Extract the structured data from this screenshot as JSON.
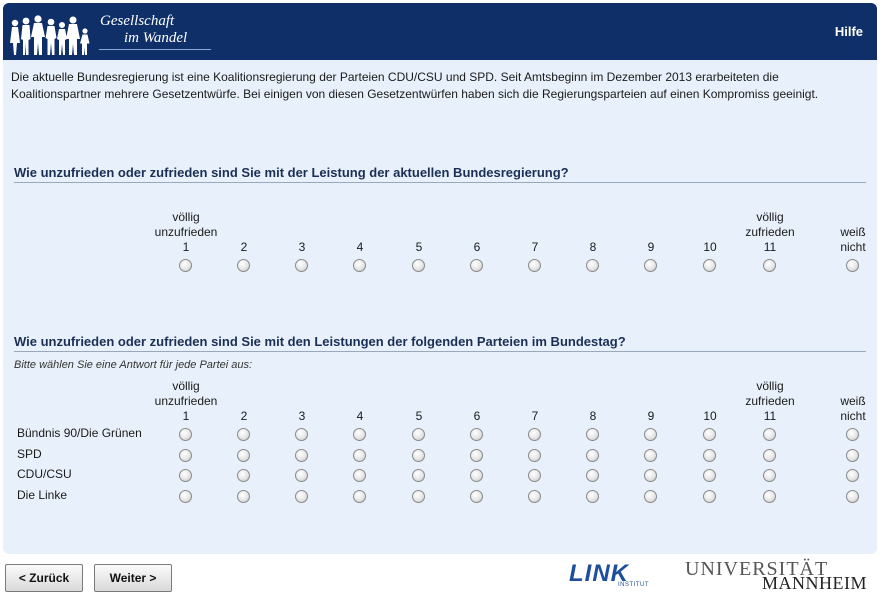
{
  "header": {
    "logo_line1": "Gesellschaft",
    "logo_line2": "im Wandel",
    "help_label": "Hilfe"
  },
  "intro_text": "Die aktuelle Bundesregierung ist eine Koalitionsregierung der Parteien CDU/CSU und SPD. Seit Amtsbeginn im Dezember 2013 erarbeiteten die Koalitionspartner mehrere Gesetzentwürfe. Bei einigen von diesen Gesetzentwürfen haben sich die Regierungsparteien auf einen Kompromiss geeinigt.",
  "scale": {
    "low_label_1": "völlig",
    "low_label_2": "unzufrieden",
    "high_label_1": "völlig",
    "high_label_2": "zufrieden",
    "dk_label_1": "weiß",
    "dk_label_2": "nicht",
    "points": [
      "1",
      "2",
      "3",
      "4",
      "5",
      "6",
      "7",
      "8",
      "9",
      "10",
      "11"
    ]
  },
  "question1": {
    "title": "Wie unzufrieden oder zufrieden sind Sie mit der Leistung der aktuellen Bundesregierung?",
    "selected": null
  },
  "question2": {
    "title": "Wie unzufrieden oder zufrieden sind Sie mit den Leistungen der folgenden Parteien im Bundestag?",
    "instruction": "Bitte wählen Sie eine Antwort für jede Partei aus:",
    "rows": [
      {
        "label": "Bündnis 90/Die Grünen",
        "selected": null
      },
      {
        "label": "SPD",
        "selected": null
      },
      {
        "label": "CDU/CSU",
        "selected": null
      },
      {
        "label": "Die Linke",
        "selected": null
      }
    ]
  },
  "nav": {
    "back_label": "< Zurück",
    "next_label": "Weiter >"
  },
  "footer": {
    "link_logo": "LINK",
    "link_sub": "INSTITUT",
    "uni_line1": "UNIVERSITÄT",
    "uni_line2": "MANNHEIM"
  },
  "colors": {
    "header_bg": "#0f2f69",
    "content_bg": "#e8f1fb",
    "title_color": "#1b2f55"
  }
}
